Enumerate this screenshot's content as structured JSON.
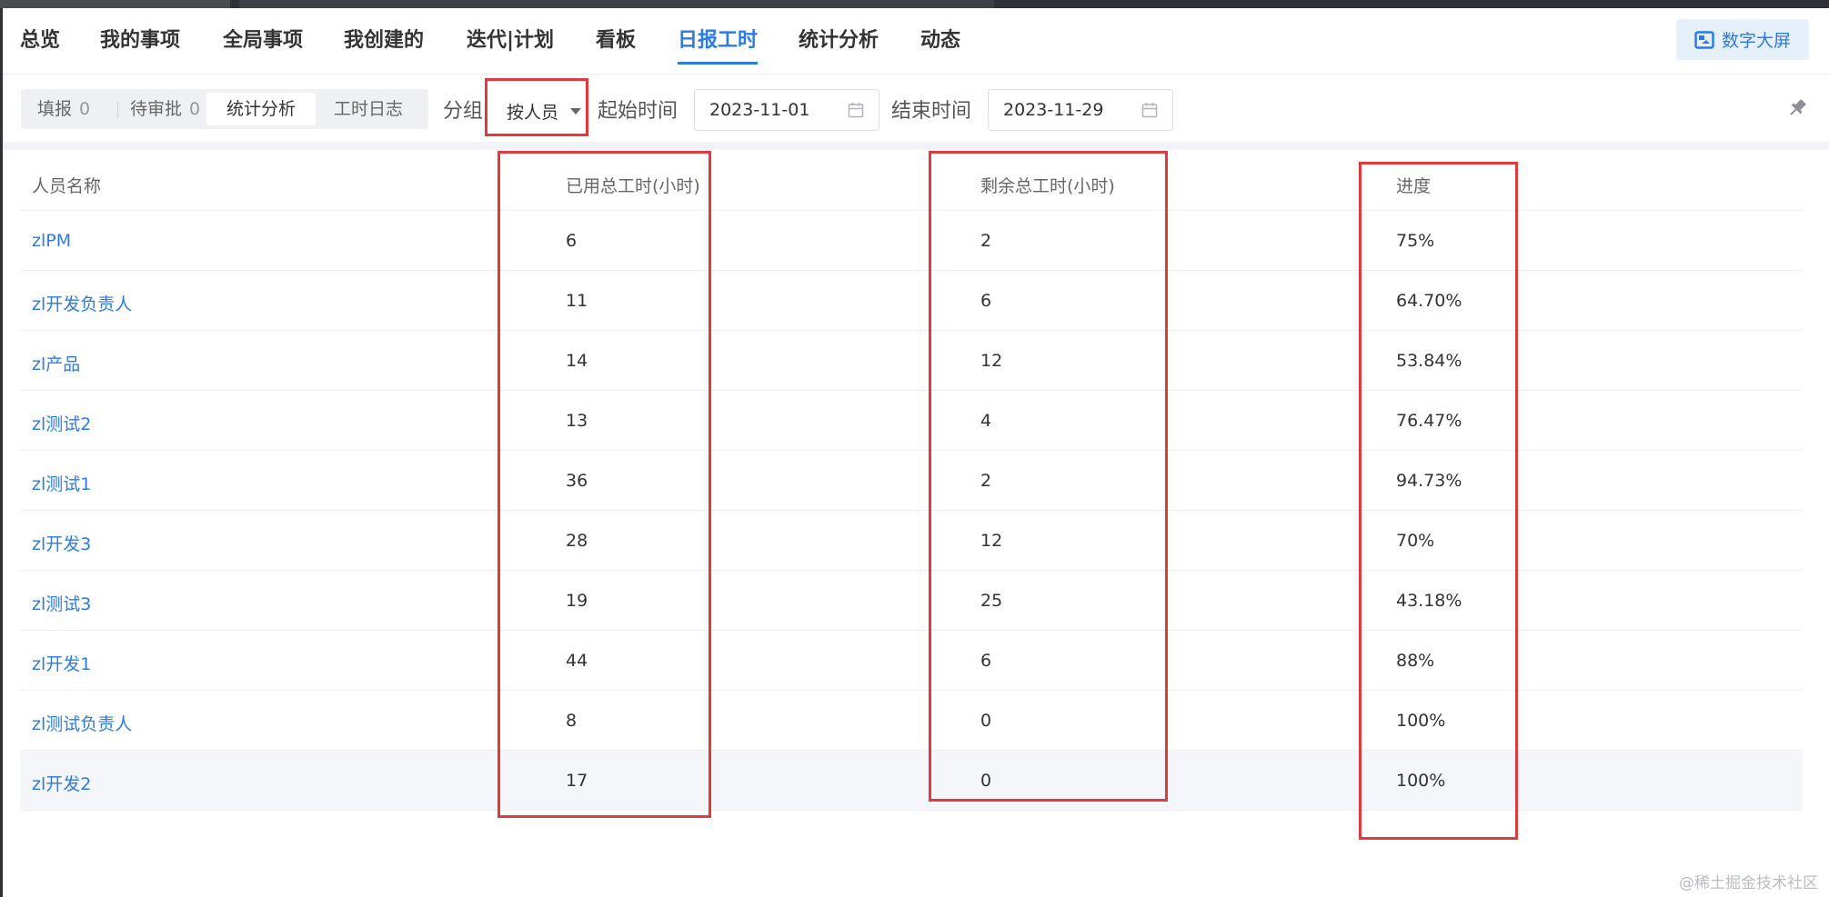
{
  "nav": {
    "tabs": [
      {
        "label": "总览"
      },
      {
        "label": "我的事项"
      },
      {
        "label": "全局事项"
      },
      {
        "label": "我创建的"
      },
      {
        "label": "迭代|计划"
      },
      {
        "label": "看板"
      },
      {
        "label": "日报工时",
        "active": true
      },
      {
        "label": "统计分析"
      },
      {
        "label": "动态"
      }
    ],
    "screen_button": "数字大屏"
  },
  "toolbar": {
    "segments": [
      {
        "label": "填报",
        "count": "0"
      },
      {
        "label": "待审批",
        "count": "0"
      },
      {
        "label": "统计分析",
        "active": true
      },
      {
        "label": "工时日志"
      }
    ],
    "group_label": "分组",
    "group_value": "按人员",
    "start_label": "起始时间",
    "start_value": "2023-11-01",
    "end_label": "结束时间",
    "end_value": "2023-11-29"
  },
  "table": {
    "headers": [
      "人员名称",
      "已用总工时(小时)",
      "剩余总工时(小时)",
      "进度"
    ],
    "rows": [
      {
        "name": "zlPM",
        "used": "6",
        "remaining": "2",
        "progress": "75%"
      },
      {
        "name": "zl开发负责人",
        "used": "11",
        "remaining": "6",
        "progress": "64.70%"
      },
      {
        "name": "zl产品",
        "used": "14",
        "remaining": "12",
        "progress": "53.84%"
      },
      {
        "name": "zl测试2",
        "used": "13",
        "remaining": "4",
        "progress": "76.47%"
      },
      {
        "name": "zl测试1",
        "used": "36",
        "remaining": "2",
        "progress": "94.73%"
      },
      {
        "name": "zl开发3",
        "used": "28",
        "remaining": "12",
        "progress": "70%"
      },
      {
        "name": "zl测试3",
        "used": "19",
        "remaining": "25",
        "progress": "43.18%"
      },
      {
        "name": "zl开发1",
        "used": "44",
        "remaining": "6",
        "progress": "88%"
      },
      {
        "name": "zl测试负责人",
        "used": "8",
        "remaining": "0",
        "progress": "100%"
      },
      {
        "name": "zl开发2",
        "used": "17",
        "remaining": "0",
        "progress": "100%"
      }
    ]
  },
  "colors": {
    "accent": "#2c7be5",
    "annotation": "#e0393e"
  },
  "watermark": "@稀土掘金技术社区"
}
